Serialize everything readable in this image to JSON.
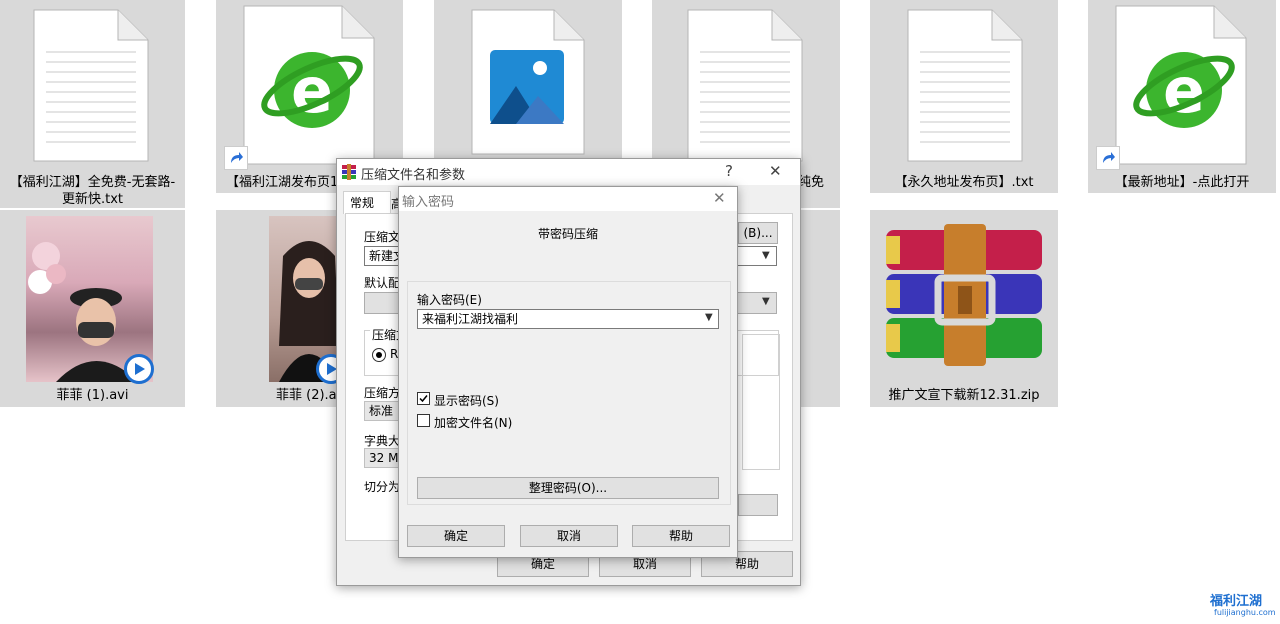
{
  "files": [
    {
      "label": "【福利江湖】全免费-无套路-更新快.txt",
      "icon": "text-file-icon"
    },
    {
      "label": "【福利江湖发布页1】",
      "icon": "browser-shortcut-icon"
    },
    {
      "label": "",
      "icon": "image-file-icon"
    },
    {
      "label": "纯免",
      "icon": "text-file-icon"
    },
    {
      "label": "【永久地址发布页】.txt",
      "icon": "text-file-icon"
    },
    {
      "label": "【最新地址】-点此打开",
      "icon": "browser-shortcut-icon"
    },
    {
      "label": "菲菲 (1).avi",
      "icon": "video-thumbnail"
    },
    {
      "label": "菲菲 (2).avi",
      "icon": "video-thumbnail"
    },
    {
      "label": "推广文宣下载新12.31.zip",
      "icon": "winrar-archive-icon"
    }
  ],
  "archive_dialog": {
    "title": "压缩文件名和参数",
    "help": "?",
    "close": "✕",
    "tab_general": "常规",
    "tab_partial": "高",
    "archive_name_label": "压缩文",
    "archive_name_value": "新建文",
    "browse_button": "(B)...",
    "default_profile_label": "默认配置",
    "format_label": "压缩文",
    "format_rar": "RA",
    "method_label": "压缩方",
    "method_value": "标准",
    "dict_label": "字典大小",
    "dict_value": "32 MB",
    "split_label": "切分为分",
    "ok": "确定",
    "cancel": "取消",
    "help_button": "帮助"
  },
  "password_dialog": {
    "title": "输入密码",
    "close": "✕",
    "heading": "带密码压缩",
    "password_label": "输入密码(E)",
    "password_value": "来福利江湖找福利",
    "show_password_label": "显示密码(S)",
    "show_password_checked": true,
    "encrypt_names_label": "加密文件名(N)",
    "encrypt_names_checked": false,
    "organize_button": "整理密码(O)...",
    "ok": "确定",
    "cancel": "取消",
    "help": "帮助"
  },
  "watermark": {
    "name": "福利江湖",
    "url": "fulijianghu.com"
  },
  "colors": {
    "tile_bg": "#d9d9d9",
    "dialog_bg": "#f0f0f0",
    "ie_green": "#3cb52e",
    "watermark_blue": "#1e6fd0"
  }
}
